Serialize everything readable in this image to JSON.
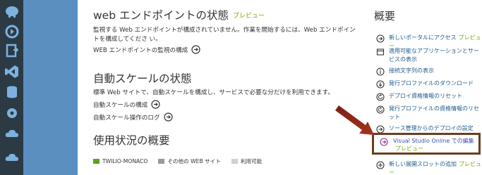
{
  "sections": {
    "web_status": {
      "title": "web エンドポイントの状態",
      "preview": "プレビュー",
      "desc": "監視する Web エンドポイントが構成されていません。作業を開始するには、Web エンドポイントを構成してくださ い。",
      "link": "WEB エンドポイントの監視の構成"
    },
    "autoscale": {
      "title": "自動スケールの状態",
      "desc": "標準 Web サイトで、自動スケールを構成し、サービスで必要な分だけを利用できます。",
      "link1": "自動スケールの構成",
      "link2": "自動スケール操作のログ"
    },
    "usage": {
      "title": "使用状況の概要",
      "legend": [
        {
          "label": "TWILIO-MONACO",
          "color": "#5aa31a"
        },
        {
          "label": "その他の WEB サイト",
          "color": "#999999"
        },
        {
          "label": "利用可能",
          "color": "#d0d0d0"
        }
      ]
    }
  },
  "overview": {
    "title": "概要",
    "items": [
      {
        "label": "新しいポータルにアクセス",
        "preview": "プレビュー",
        "icon": "arrow-circle-icon"
      },
      {
        "label": "適用可能なアプリケーションとサービスの表示",
        "icon": "box-icon"
      },
      {
        "label": "接続文字列の表示",
        "icon": "info-icon"
      },
      {
        "label": "発行プロファイルのダウンロード",
        "icon": "download-icon"
      },
      {
        "label": "デプロイ資格情報のリセット",
        "icon": "reset-icon"
      },
      {
        "label": "発行プロファイルの資格情報のリセット",
        "icon": "reset-icon"
      },
      {
        "label": "ソース管理からのデプロイの設定",
        "icon": "arrow-circle-icon"
      },
      {
        "label": "Visual Studio Online での編集",
        "preview": "プレビュー",
        "icon": "arrow-circle-icon"
      },
      {
        "label": "新しい展開スロットの追加",
        "preview": "プレビュー",
        "icon": "plus-icon"
      }
    ]
  }
}
